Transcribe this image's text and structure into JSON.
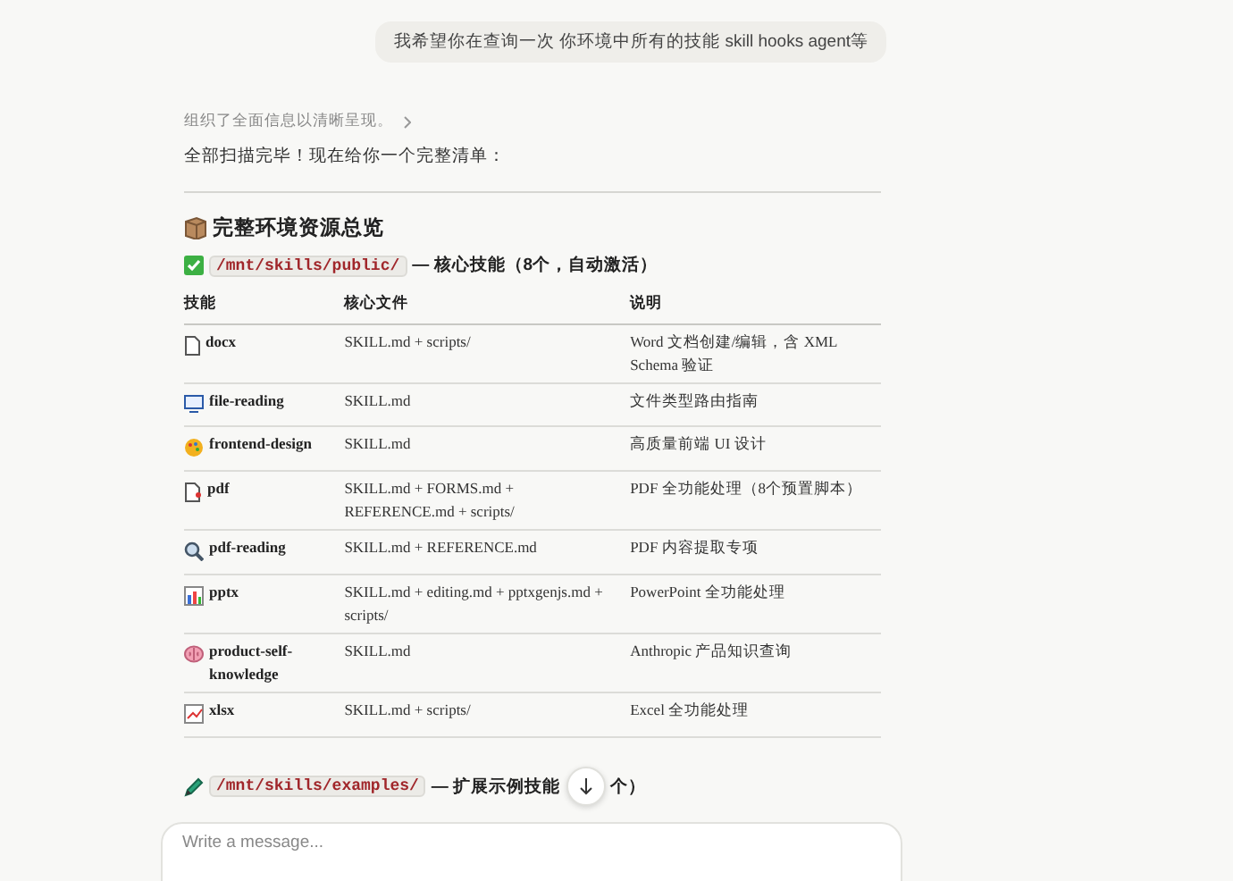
{
  "user_message": "我希望你在查询一次 你环境中所有的技能 skill hooks agent等",
  "thinking_summary": "组织了全面信息以清晰呈现。",
  "intro": "全部扫描完毕！现在给你一个完整清单：",
  "section_title": "完整环境资源总览",
  "public_heading": {
    "path": "/mnt/skills/public/",
    "text": "— 核心技能（8个，自动激活）"
  },
  "table": {
    "columns": [
      "技能",
      "核心文件",
      "说明"
    ],
    "rows": [
      {
        "name": "docx",
        "files": "SKILL.md + scripts/",
        "desc": "Word 文档创建/编辑，含 XML Schema 验证"
      },
      {
        "name": "file-reading",
        "files": "SKILL.md",
        "desc": "文件类型路由指南"
      },
      {
        "name": "frontend-design",
        "files": "SKILL.md",
        "desc": "高质量前端 UI 设计"
      },
      {
        "name": "pdf",
        "files": "SKILL.md + FORMS.md + REFERENCE.md + scripts/",
        "desc": "PDF 全功能处理（8个预置脚本）"
      },
      {
        "name": "pdf-reading",
        "files": "SKILL.md + REFERENCE.md",
        "desc": "PDF 内容提取专项"
      },
      {
        "name": "pptx",
        "files": "SKILL.md + editing.md + pptxgenjs.md + scripts/",
        "desc": "PowerPoint 全功能处理"
      },
      {
        "name": "product-self-knowledge",
        "files": "SKILL.md",
        "desc": "Anthropic 产品知识查询"
      },
      {
        "name": "xlsx",
        "files": "SKILL.md + scripts/",
        "desc": "Excel 全功能处理"
      }
    ]
  },
  "examples_heading": {
    "path": "/mnt/skills/examples/",
    "text": "— 扩展示例技能",
    "tail": "个）"
  },
  "composer": {
    "placeholder": "Write a message..."
  }
}
